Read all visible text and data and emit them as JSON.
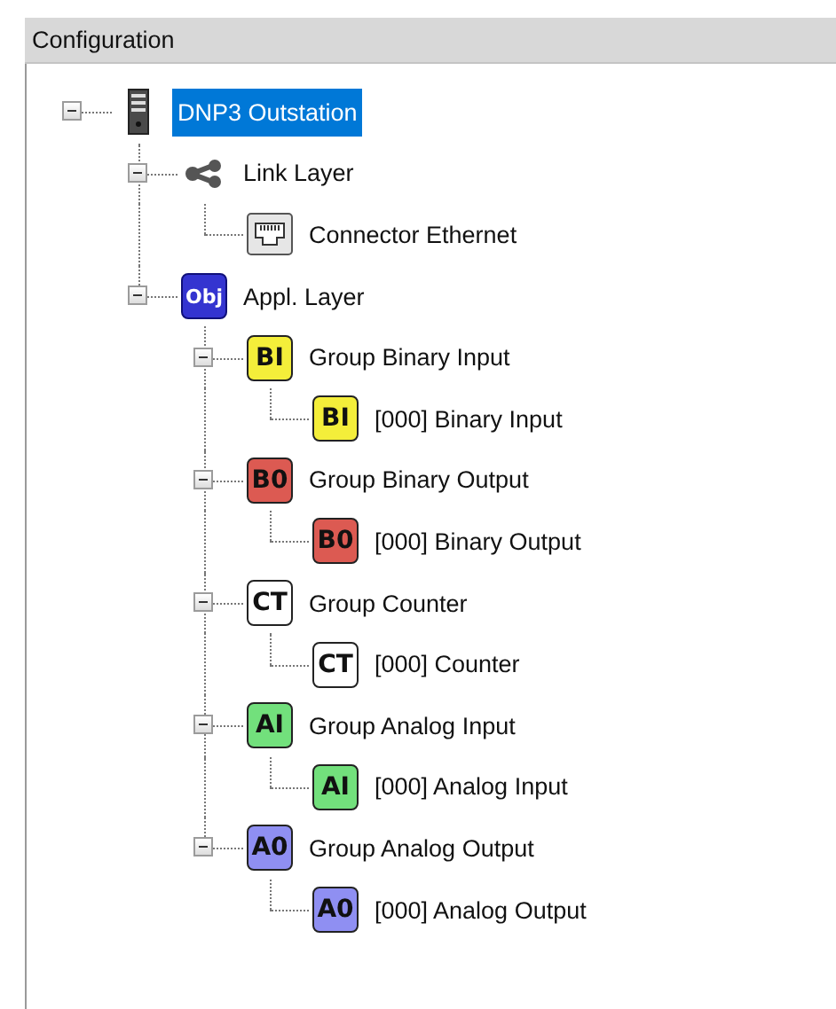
{
  "panel": {
    "title": "Configuration"
  },
  "tree": [
    {
      "label": "DNP3 Outstation",
      "kind": "server",
      "selected": true,
      "expanded": true,
      "children": [
        {
          "label": "Link Layer",
          "kind": "network",
          "selected": false,
          "expanded": true,
          "children": [
            {
              "label": "Connector Ethernet",
              "kind": "ethernet",
              "selected": false
            }
          ]
        },
        {
          "label": "Appl. Layer",
          "kind": "object",
          "badge": "Obj",
          "color": "#3434d0",
          "selected": false,
          "expanded": true,
          "children": [
            {
              "label": "Group Binary Input",
              "kind": "badge",
              "badge": "BI",
              "color": "#f4ee3a",
              "selected": false,
              "expanded": true,
              "children": [
                {
                  "label": "[000] Binary Input",
                  "kind": "badge",
                  "badge": "BI",
                  "color": "#f4ee3a",
                  "selected": false
                }
              ]
            },
            {
              "label": "Group Binary Output",
              "kind": "badge",
              "badge": "B0",
              "color": "#dc5a52",
              "selected": false,
              "expanded": true,
              "children": [
                {
                  "label": "[000] Binary Output",
                  "kind": "badge",
                  "badge": "B0",
                  "color": "#dc5a52",
                  "selected": false
                }
              ]
            },
            {
              "label": "Group Counter",
              "kind": "badge",
              "badge": "CT",
              "color": "#ffffff",
              "selected": false,
              "expanded": true,
              "children": [
                {
                  "label": "[000] Counter",
                  "kind": "badge",
                  "badge": "CT",
                  "color": "#ffffff",
                  "selected": false
                }
              ]
            },
            {
              "label": "Group Analog Input",
              "kind": "badge",
              "badge": "AI",
              "color": "#72e07c",
              "selected": false,
              "expanded": true,
              "children": [
                {
                  "label": "[000] Analog Input",
                  "kind": "badge",
                  "badge": "AI",
                  "color": "#72e07c",
                  "selected": false
                }
              ]
            },
            {
              "label": "Group Analog Output",
              "kind": "badge",
              "badge": "A0",
              "color": "#8f8ff2",
              "selected": false,
              "expanded": true,
              "children": [
                {
                  "label": "[000] Analog Output",
                  "kind": "badge",
                  "badge": "A0",
                  "color": "#8f8ff2",
                  "selected": false
                }
              ]
            }
          ]
        }
      ]
    }
  ]
}
